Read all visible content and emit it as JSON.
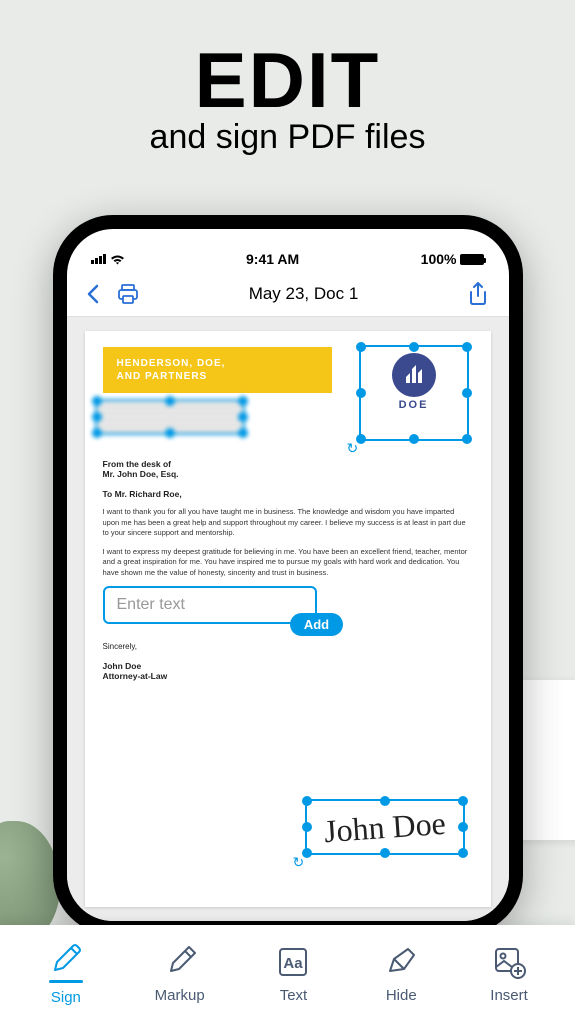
{
  "hero": {
    "title": "EDIT",
    "subtitle": "and sign PDF files"
  },
  "status": {
    "time": "9:41 AM",
    "battery": "100%"
  },
  "nav": {
    "title": "May 23, Doc 1"
  },
  "doc": {
    "banner_line1": "HENDERSON, DOE,",
    "banner_line2": "AND PARTNERS",
    "logo_label": "DOE",
    "from_label": "From the desk of",
    "from_name": "Mr. John Doe, Esq.",
    "addressee": "To Mr. Richard Roe,",
    "para1": "I want to thank you for all you have taught me in business. The knowledge and wisdom you have imparted upon me has been a great help and support throughout my career. I believe my success is at least in part due to your sincere support and mentorship.",
    "para2": "I want to express my deepest gratitude for believing in me. You have been an excellent friend, teacher, mentor and a great inspiration for me. You have inspired me to pursue my goals with hard work and dedication. You have shown me the value of honesty, sincerity and trust in business.",
    "text_placeholder": "Enter text",
    "add_label": "Add",
    "closing": "Sincerely,",
    "sig_name": "John Doe",
    "sig_title": "Attorney-at-Law",
    "signature": "John Doe"
  },
  "toolbar": {
    "items": [
      {
        "label": "Sign"
      },
      {
        "label": "Markup"
      },
      {
        "label": "Text"
      },
      {
        "label": "Hide"
      },
      {
        "label": "Insert"
      }
    ]
  }
}
